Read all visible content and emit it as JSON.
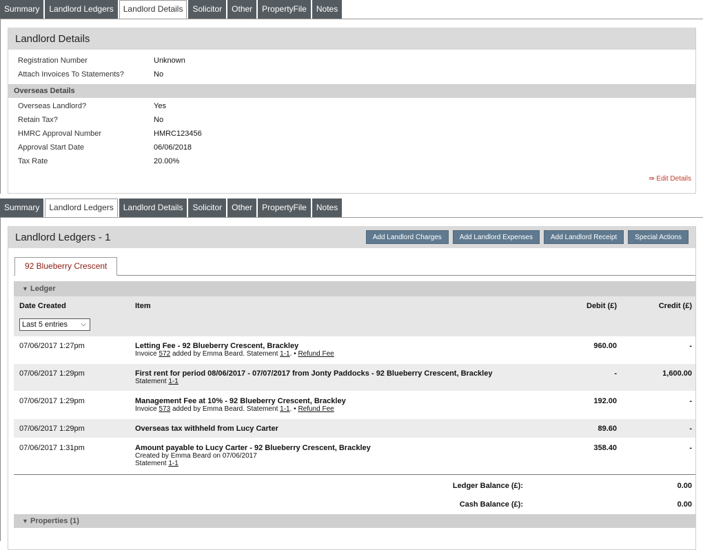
{
  "tabs_top": [
    "Summary",
    "Landlord Ledgers",
    "Landlord Details",
    "Solicitor",
    "Other",
    "PropertyFile",
    "Notes"
  ],
  "tabs_bottom": [
    "Summary",
    "Landlord Ledgers",
    "Landlord Details",
    "Solicitor",
    "Other",
    "PropertyFile",
    "Notes"
  ],
  "details": {
    "title": "Landlord Details",
    "fields": [
      {
        "k": "Registration Number",
        "v": "Unknown"
      },
      {
        "k": "Attach Invoices To Statements?",
        "v": "No"
      }
    ],
    "overseas_title": "Overseas Details",
    "overseas": [
      {
        "k": "Overseas Landlord?",
        "v": "Yes"
      },
      {
        "k": "Retain Tax?",
        "v": "No"
      },
      {
        "k": "HMRC Approval Number",
        "v": "HMRC123456"
      },
      {
        "k": "Approval Start Date",
        "v": "06/06/2018"
      },
      {
        "k": "Tax Rate",
        "v": "20.00%"
      }
    ],
    "edit_label": "Edit Details"
  },
  "ledgers": {
    "title": "Landlord Ledgers - 1",
    "buttons": [
      "Add Landlord Charges",
      "Add Landlord Expenses",
      "Add Landlord Receipt",
      "Special Actions"
    ],
    "property_tab": "92 Blueberry Crescent",
    "ledger_bar": "Ledger",
    "properties_bar": "Properties (1)",
    "columns": {
      "date": "Date Created",
      "item": "Item",
      "debit": "Debit (£)",
      "credit": "Credit (£)"
    },
    "filter_value": "Last 5 entries",
    "rows": [
      {
        "date": "07/06/2017 1:27pm",
        "main": "Letting Fee - 92 Blueberry Crescent, Brackley",
        "sub1": "Invoice",
        "inv": "572",
        "sub2": "added by Emma Beard. Statement",
        "stmt": "1-1",
        "refund": "Refund Fee",
        "debit": "960.00",
        "credit": "-"
      },
      {
        "date": "07/06/2017 1:29pm",
        "main": "First rent for period 08/06/2017 - 07/07/2017 from Jonty Paddocks - 92 Blueberry Crescent, Brackley",
        "sub_stmt_label": "Statement",
        "stmt": "1-1",
        "debit": "-",
        "credit": "1,600.00"
      },
      {
        "date": "07/06/2017 1:29pm",
        "main": "Management Fee at 10% - 92 Blueberry Crescent, Brackley",
        "sub1": "Invoice",
        "inv": "573",
        "sub2": "added by Emma Beard. Statement",
        "stmt": "1-1",
        "refund": "Refund Fee",
        "debit": "192.00",
        "credit": "-"
      },
      {
        "date": "07/06/2017 1:29pm",
        "main": "Overseas tax withheld from Lucy Carter",
        "debit": "89.60",
        "credit": "-"
      },
      {
        "date": "07/06/2017 1:31pm",
        "main": "Amount payable to Lucy Carter - 92 Blueberry Crescent, Brackley",
        "created": "Created by Emma Beard on 07/06/2017",
        "sub_stmt_label": "Statement",
        "stmt": "1-1",
        "debit": "358.40",
        "credit": "-"
      }
    ],
    "ledger_balance_label": "Ledger Balance (£):",
    "ledger_balance": "0.00",
    "cash_balance_label": "Cash Balance (£):",
    "cash_balance": "0.00"
  }
}
